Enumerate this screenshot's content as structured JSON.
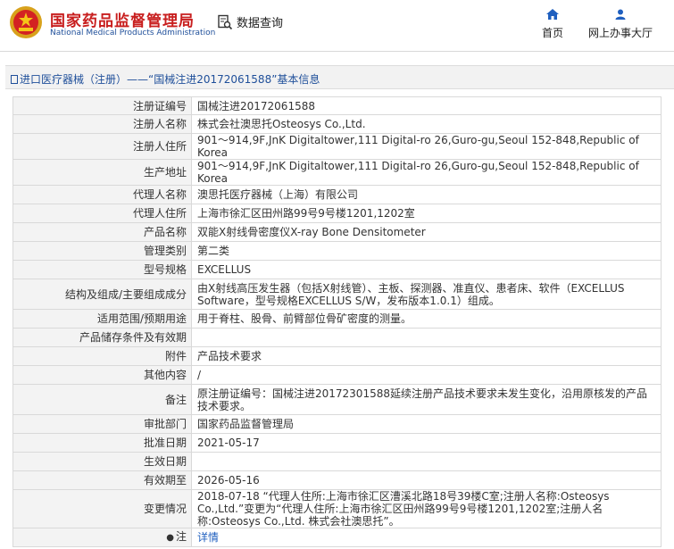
{
  "header": {
    "logo_cn": "国家药品监督管理局",
    "logo_en": "National Medical Products Administration",
    "search_label": "数据查询",
    "nav": [
      {
        "label": "首页",
        "icon": "home-icon"
      },
      {
        "label": "网上办事大厅",
        "icon": "user-icon"
      }
    ]
  },
  "title": "进口医疗器械（注册）——“国械注进20172061588”基本信息",
  "rows": [
    {
      "key": "注册证编号",
      "value": "国械注进20172061588"
    },
    {
      "key": "注册人名称",
      "value": "株式会社澳思托Osteosys Co.,Ltd."
    },
    {
      "key": "注册人住所",
      "value": "901～914,9F,JnK Digitaltower,111 Digital-ro 26,Guro-gu,Seoul 152-848,Republic of Korea"
    },
    {
      "key": "生产地址",
      "value": "901～914,9F,JnK Digitaltower,111 Digital-ro 26,Guro-gu,Seoul 152-848,Republic of Korea"
    },
    {
      "key": "代理人名称",
      "value": "澳思托医疗器械（上海）有限公司"
    },
    {
      "key": "代理人住所",
      "value": "上海市徐汇区田州路99号9号楼1201,1202室"
    },
    {
      "key": "产品名称",
      "value": "双能X射线骨密度仪X-ray Bone Densitometer"
    },
    {
      "key": "管理类别",
      "value": "第二类"
    },
    {
      "key": "型号规格",
      "value": "EXCELLUS"
    },
    {
      "key": "结构及组成/主要组成成分",
      "value": "由X射线高压发生器（包括X射线管）、主板、探测器、准直仪、患者床、软件（EXCELLUS Software，型号规格EXCELLUS S/W，发布版本1.0.1）组成。"
    },
    {
      "key": "适用范围/预期用途",
      "value": "用于脊柱、股骨、前臂部位骨矿密度的测量。"
    },
    {
      "key": "产品储存条件及有效期",
      "value": ""
    },
    {
      "key": "附件",
      "value": "产品技术要求"
    },
    {
      "key": "其他内容",
      "value": "/"
    },
    {
      "key": "备注",
      "value": "原注册证编号：国械注进20172301588延续注册产品技术要求未发生变化，沿用原核发的产品技术要求。"
    },
    {
      "key": "审批部门",
      "value": "国家药品监督管理局"
    },
    {
      "key": "批准日期",
      "value": "2021-05-17"
    },
    {
      "key": "生效日期",
      "value": ""
    },
    {
      "key": "有效期至",
      "value": "2026-05-16"
    },
    {
      "key": "变更情况",
      "value": "2018-07-18 “代理人住所:上海市徐汇区漕溪北路18号39楼C室;注册人名称:Osteosys Co.,Ltd.”变更为“代理人住所:上海市徐汇区田州路99号9号楼1201,1202室;注册人名称:Osteosys Co.,Ltd. 株式会社澳思托”。"
    }
  ],
  "note": {
    "key": "注",
    "link": "详情"
  }
}
